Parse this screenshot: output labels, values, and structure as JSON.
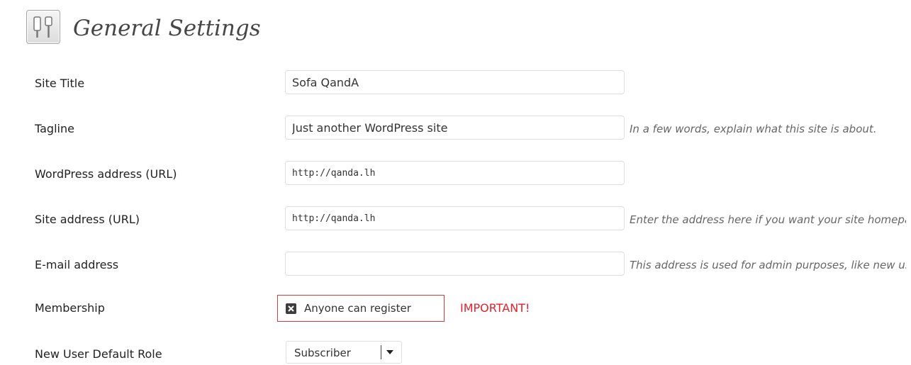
{
  "page": {
    "title": "General Settings",
    "icon": "settings-sliders-icon"
  },
  "fields": {
    "site_title": {
      "label": "Site Title",
      "value": "Sofa QandA"
    },
    "tagline": {
      "label": "Tagline",
      "value": "Just another WordPress site",
      "description": "In a few words, explain what this site is about."
    },
    "wordpress_address": {
      "label": "WordPress address (URL)",
      "value": "http://qanda.lh"
    },
    "site_address": {
      "label": "Site address (URL)",
      "value": "http://qanda.lh",
      "description": "Enter the address here if you want your site homepage to be different from the directory you installed WordPress."
    },
    "email": {
      "label": "E-mail address",
      "value": "",
      "description": "This address is used for admin purposes, like new user notification."
    },
    "membership": {
      "label": "Membership",
      "checkbox_label": "Anyone can register",
      "checked": true,
      "note": "IMPORTANT!",
      "note_color": "#e8202a"
    },
    "default_role": {
      "label": "New User Default Role",
      "selected": "Subscriber"
    }
  }
}
